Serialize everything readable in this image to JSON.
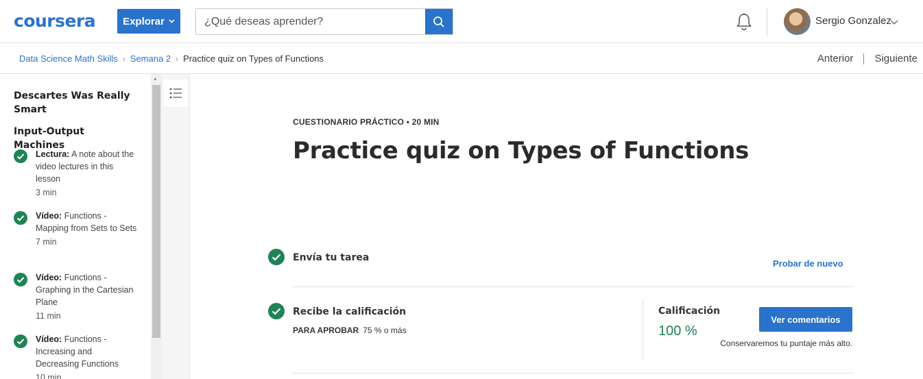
{
  "header": {
    "logo": "coursera",
    "explore_label": "Explorar",
    "search_placeholder": "¿Qué deseas aprender?",
    "user_name": "Sergio Gonzalez"
  },
  "breadcrumb": {
    "items": [
      "Data Science Math Skills",
      "Semana 2",
      "Practice quiz on Types of Functions"
    ],
    "prev": "Anterior",
    "next": "Siguiente"
  },
  "sidebar": {
    "sections": [
      "Descartes Was Really Smart",
      "Input-Output Machines"
    ],
    "items": [
      {
        "type": "Lectura:",
        "title": "A note about the video lectures in this lesson",
        "duration": "3 min"
      },
      {
        "type": "Vídeo:",
        "title": "Functions - Mapping from Sets to Sets",
        "duration": "7 min"
      },
      {
        "type": "Vídeo:",
        "title": "Functions - Graphing in the Cartesian Plane",
        "duration": "11 min"
      },
      {
        "type": "Vídeo:",
        "title": "Functions - Increasing and Decreasing Functions",
        "duration": "10 min"
      }
    ]
  },
  "main": {
    "kicker": "CUESTIONARIO PRÁCTICO • 20 MIN",
    "title": "Practice quiz on Types of Functions",
    "step1_title": "Envía tu tarea",
    "retry": "Probar de nuevo",
    "step2_title": "Recibe la calificación",
    "pass_label": "PARA APROBAR",
    "pass_value": "75 % o más",
    "grade_label": "Calificación",
    "grade_value": "100 %",
    "feedback_button": "Ver comentarios",
    "keep_note": "Conservaremos tu puntaje más alto."
  },
  "colors": {
    "brand": "#2a73cc",
    "success": "#1f8354"
  }
}
